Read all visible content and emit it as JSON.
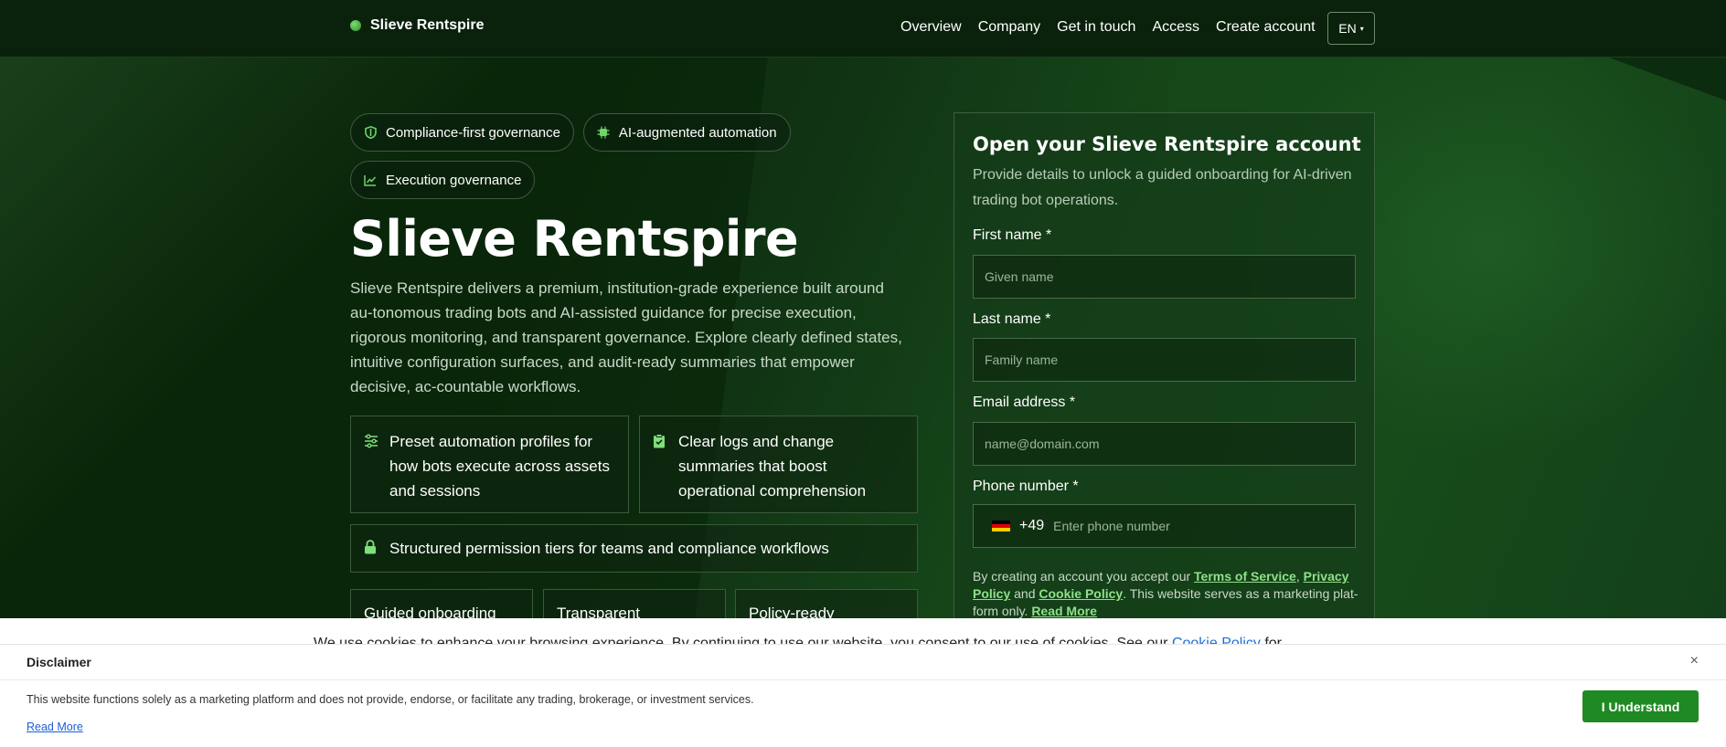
{
  "header": {
    "brand": "Slieve Rentspire",
    "nav": [
      "Overview",
      "Company",
      "Get in touch",
      "Access",
      "Create account"
    ],
    "lang": "EN"
  },
  "hero": {
    "pills": [
      {
        "label": "Compliance-first governance",
        "icon": "shield-icon"
      },
      {
        "label": "AI-augmented automation",
        "icon": "chip-icon"
      },
      {
        "label": "Execution governance",
        "icon": "chart-line-icon"
      }
    ],
    "title": "Slieve Rentspire",
    "description": "Slieve Rentspire delivers a premium, institution-grade experience built around au-tonomous trading bots and AI-assisted guidance for precise execution, rigorous monitoring, and transparent governance. Explore clearly defined states, intuitive configuration surfaces, and audit-ready summaries that empower decisive, ac-countable workflows.",
    "features": [
      {
        "text": "Preset automation profiles for how bots execute across assets and sessions",
        "icon": "sliders-icon"
      },
      {
        "text": "Clear logs and change summaries that boost operational comprehension",
        "icon": "clipboard-icon"
      },
      {
        "text": "Structured permission tiers for teams and compliance workflows",
        "icon": "lock-icon"
      }
    ],
    "small_features": [
      "Guided onboarding",
      "Transparent",
      "Policy-ready"
    ]
  },
  "form": {
    "title": "Open your Slieve Rentspire account",
    "subtitle": "Provide details to unlock a guided onboarding for AI-driven trading bot operations.",
    "first_name_label": "First name *",
    "first_name_placeholder": "Given name",
    "last_name_label": "Last name *",
    "last_name_placeholder": "Family name",
    "email_label": "Email address *",
    "email_placeholder": "name@domain.com",
    "phone_label": "Phone number *",
    "phone_code": "+49",
    "phone_placeholder": "Enter phone number",
    "terms_prefix": "By creating an account you accept our ",
    "terms_link": "Terms of Service",
    "comma": ", ",
    "privacy_link": "Privacy Policy",
    "and": " and ",
    "cookie_link": "Cookie Policy",
    "terms_suffix": ". This website serves as a marketing plat-form only. ",
    "read_more": "Read More"
  },
  "cookie_notice": {
    "text": "We use cookies to enhance your browsing experience. By continuing to use our website, you consent to our use of cookies. See our",
    "link": "Cookie Policy",
    "suffix": "for"
  },
  "disclaimer": {
    "title": "Disclaimer",
    "body": "This website functions solely as a marketing platform and does not provide, endorse, or facilitate any trading, brokerage, or investment services.",
    "read_more": "Read More",
    "button": "I Understand",
    "close": "×"
  },
  "colors": {
    "accent": "#1f8a23",
    "link_green": "#8fe08a",
    "background": "#0d2a10"
  }
}
